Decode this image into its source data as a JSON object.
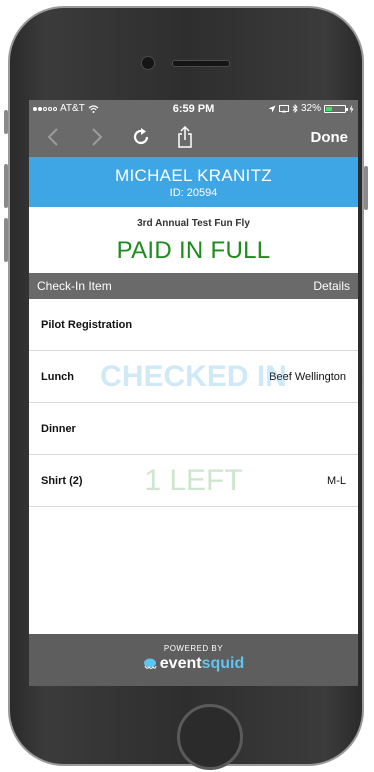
{
  "status_bar": {
    "carrier": "AT&T",
    "time": "6:59 PM",
    "battery_percent": "32%",
    "battery_level": 0.32
  },
  "toolbar": {
    "done_label": "Done",
    "icons": [
      "back-arrow-icon",
      "forward-arrow-icon",
      "refresh-icon",
      "share-icon"
    ]
  },
  "attendee": {
    "name": "MICHAEL KRANITZ",
    "id_text": "ID: 20594"
  },
  "event": {
    "name": "3rd Annual Test Fun Fly",
    "payment_status": "PAID IN FULL"
  },
  "list_header": {
    "item_label": "Check-In Item",
    "details_label": "Details"
  },
  "items": [
    {
      "label": "Pilot Registration",
      "detail": "",
      "overlay": ""
    },
    {
      "label": "Lunch",
      "detail": "Beef Wellington",
      "overlay": "CHECKED IN"
    },
    {
      "label": "Dinner",
      "detail": "",
      "overlay": ""
    },
    {
      "label": "Shirt (2)",
      "detail": "M-L",
      "overlay": "1 LEFT"
    }
  ],
  "footer": {
    "powered_by": "POWERED BY",
    "brand_prefix": "event",
    "brand_suffix": "squid"
  },
  "colors": {
    "name_band": "#3fa6e6",
    "paid_text": "#1c8c1c",
    "bars": "#6a6a6a"
  }
}
